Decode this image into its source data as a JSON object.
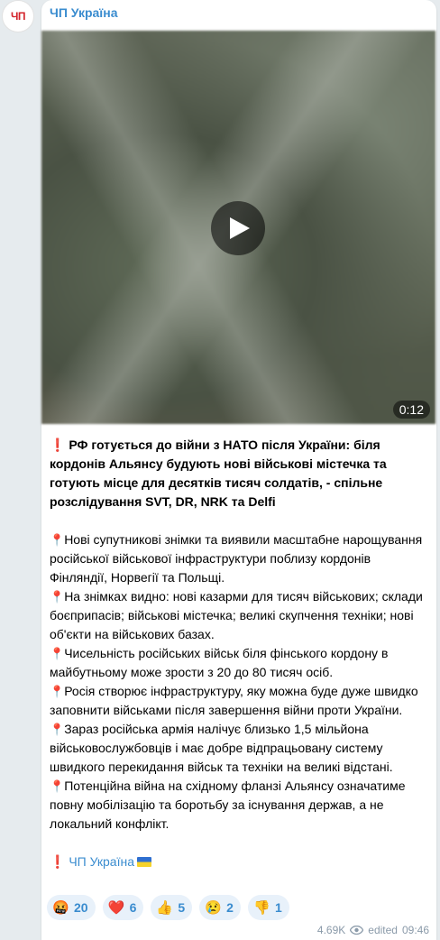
{
  "channel": {
    "name": "ЧП Україна",
    "avatar_text": "ЧП"
  },
  "video": {
    "duration": "0:12"
  },
  "post": {
    "headline": "РФ готується до війни з НАТО після України: біля кордонів Альянсу будують нові військові містечка та готують місце для десятків тисяч солдатів, - спільне розслідування SVT, DR, NRK та Delfi",
    "points": [
      "Нові супутникові знімки та виявили масштабне нарощування російської військової інфраструктури поблизу кордонів Фінляндії, Норвегії та Польщі.",
      "На знімках видно: нові казарми для тисяч військових; склади боєприпасів; військові містечка; великі скупчення техніки; нові об'єкти на військових базах.",
      "Чисельність російських військ біля фінського кордону в майбутньому може зрости з 20 до 80 тисяч осіб.",
      "Росія створює інфраструктуру, яку можна буде дуже швидко заповнити військами після завершення війни проти України.",
      "Зараз російська армія налічує близько 1,5 мільйона військовослужбовців і має добре відпрацьовану систему швидкого перекидання військ та техніки на великі відстані.",
      "Потенційна війна на східному фланзі Альянсу означатиме повну мобілізацію та боротьбу за існування держав, а не локальний конфлікт."
    ],
    "signature": "ЧП Україна"
  },
  "reactions": [
    {
      "emoji": "🤬",
      "icon": "angry-face-icon",
      "count": "20"
    },
    {
      "emoji": "❤️",
      "icon": "heart-icon",
      "count": "6"
    },
    {
      "emoji": "👍",
      "icon": "thumbs-up-icon",
      "count": "5"
    },
    {
      "emoji": "😢",
      "icon": "crying-face-icon",
      "count": "2"
    },
    {
      "emoji": "👎",
      "icon": "thumbs-down-icon",
      "count": "1"
    }
  ],
  "meta": {
    "views": "4.69K",
    "edited": "edited",
    "time": "09:46"
  },
  "colors": {
    "accent": "#3a8ccf",
    "reaction_bg": "#e8f1fa",
    "bg": "#e6ebee"
  }
}
